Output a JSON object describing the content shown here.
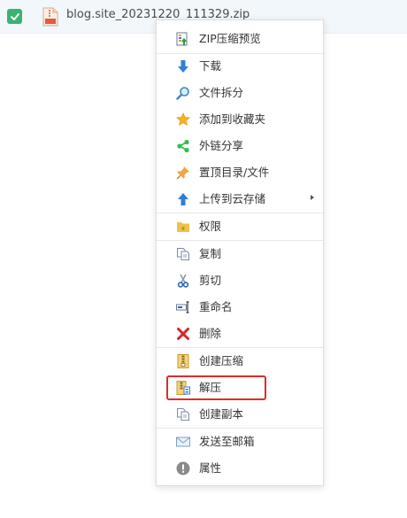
{
  "file": {
    "name": "blog.site_20231220_111329.zip",
    "icon": "zip-file-icon",
    "checked": true
  },
  "menu": {
    "items": [
      {
        "label": "ZIP压缩预览",
        "icon": "zip-preview-icon",
        "color": "#2e7d32"
      },
      {
        "label": "下载",
        "icon": "download-arrow-icon",
        "color": "#2f7fd8"
      },
      {
        "label": "文件拆分",
        "icon": "split-search-icon",
        "color": "#3b86d1"
      },
      {
        "label": "添加到收藏夹",
        "icon": "star-icon",
        "color": "#f5b323"
      },
      {
        "label": "外链分享",
        "icon": "share-icon",
        "color": "#2fbf4f"
      },
      {
        "label": "置顶目录/文件",
        "icon": "pin-icon",
        "color": "#f2a640"
      },
      {
        "label": "上传到云存储",
        "icon": "upload-arrow-icon",
        "color": "#2f7fd8"
      },
      {
        "label": "权限",
        "icon": "folder-permission-icon",
        "color": "#f1c24a"
      },
      {
        "label": "复制",
        "icon": "copy-icon",
        "color": "#7a8aa3"
      },
      {
        "label": "剪切",
        "icon": "scissors-icon",
        "color": "#2a66b5"
      },
      {
        "label": "重命名",
        "icon": "rename-icon",
        "color": "#2a66b5"
      },
      {
        "label": "删除",
        "icon": "delete-x-icon",
        "color": "#d32626"
      },
      {
        "label": "创建压缩",
        "icon": "archive-icon",
        "color": "#d9b44a"
      },
      {
        "label": "解压",
        "icon": "extract-icon",
        "color": "#d9b44a"
      },
      {
        "label": "创建副本",
        "icon": "duplicate-icon",
        "color": "#7a8aa3"
      },
      {
        "label": "发送至邮箱",
        "icon": "mail-icon",
        "color": "#7f9fc3"
      },
      {
        "label": "属性",
        "icon": "info-icon",
        "color": "#8a8a8a"
      }
    ]
  },
  "highlight_color": "#e02b2b"
}
